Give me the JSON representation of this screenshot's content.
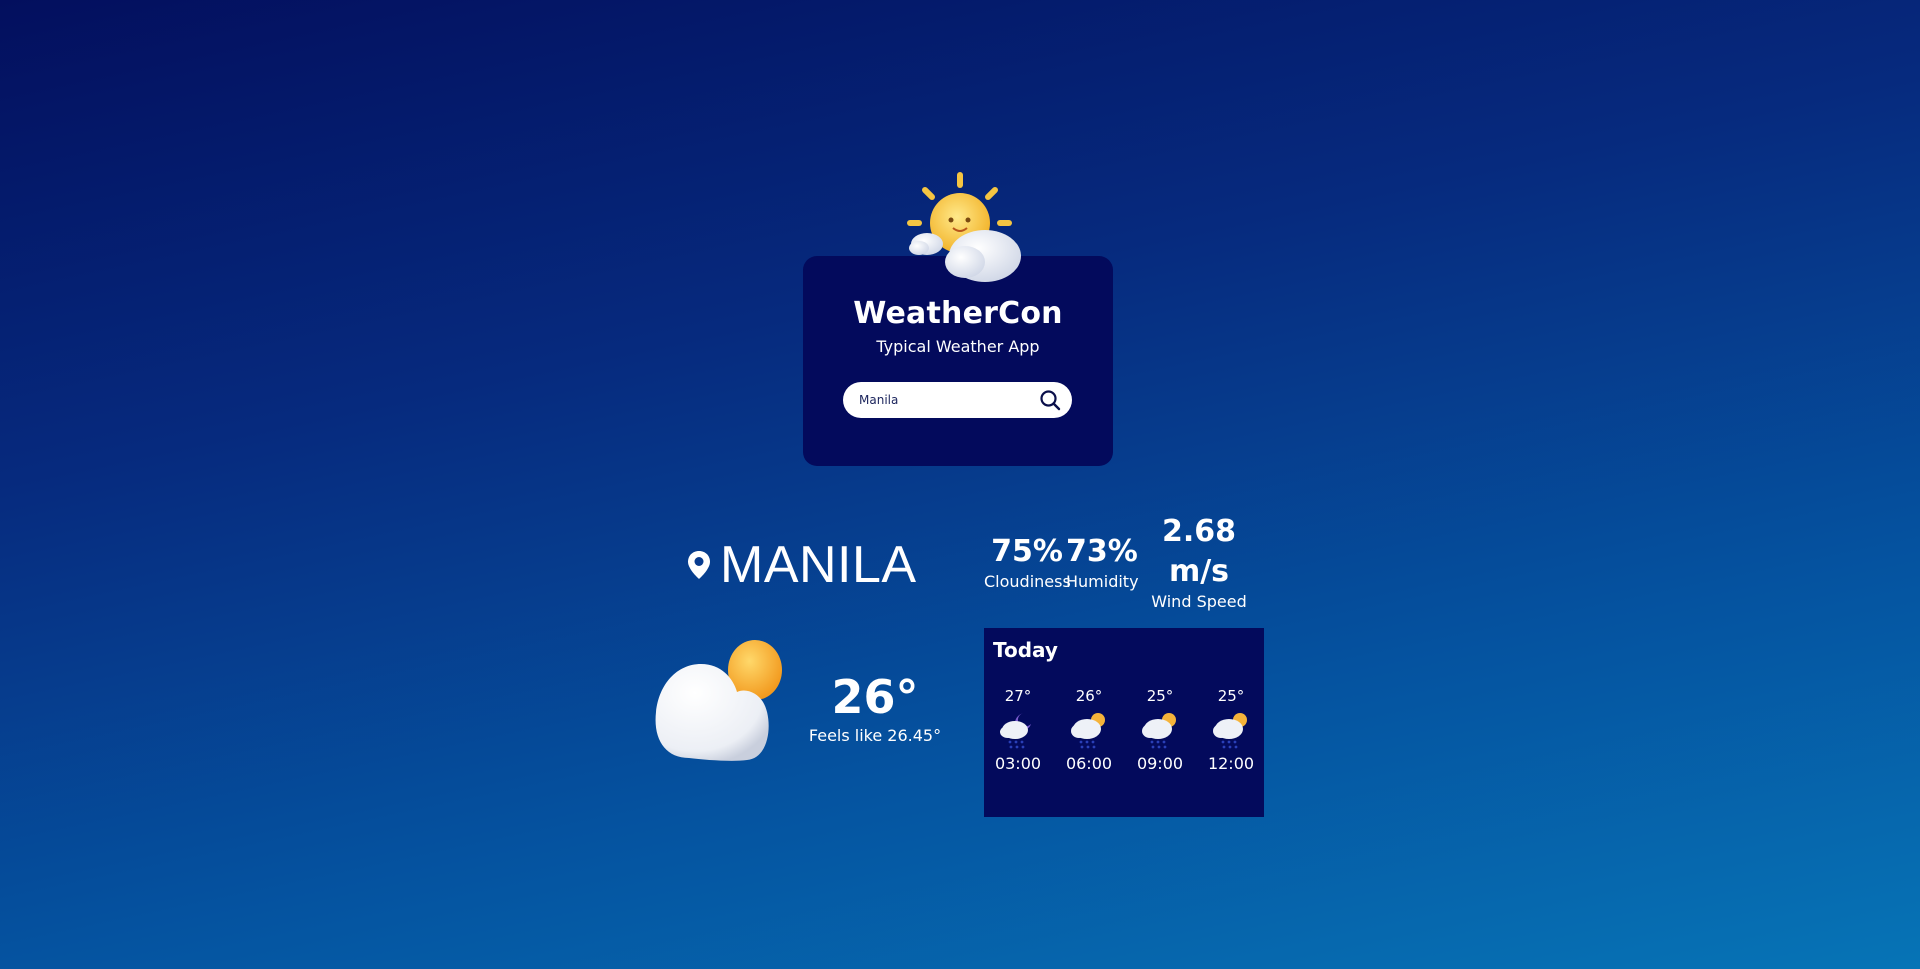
{
  "app": {
    "title": "WeatherCon",
    "subtitle": "Typical Weather App",
    "hero_icon": "sun-with-clouds-icon"
  },
  "search": {
    "value": "Manila",
    "icon": "search-icon"
  },
  "current": {
    "city": "MANILA",
    "location_icon": "map-pin-icon",
    "condition_icon": "cloud-sun-icon",
    "temperature": "26°",
    "feels_like": "Feels like 26.45°"
  },
  "stats": {
    "cloudiness": {
      "value": "75%",
      "label": "Cloudiness"
    },
    "humidity": {
      "value": "73%",
      "label": "Humidity"
    },
    "wind": {
      "value_line1": "2.68",
      "value_line2": "m/s",
      "label": "Wind Speed"
    }
  },
  "forecast": {
    "title": "Today",
    "hours": [
      {
        "temp": "27°",
        "time": "03:00",
        "icon": "moon-rain-icon"
      },
      {
        "temp": "26°",
        "time": "06:00",
        "icon": "sun-rain-icon"
      },
      {
        "temp": "25°",
        "time": "09:00",
        "icon": "sun-rain-icon"
      },
      {
        "temp": "25°",
        "time": "12:00",
        "icon": "sun-rain-icon"
      }
    ]
  },
  "colors": {
    "card_bg": "#030a5c",
    "accent_sun": "#f5b33a",
    "rain": "#2a3fb8"
  }
}
